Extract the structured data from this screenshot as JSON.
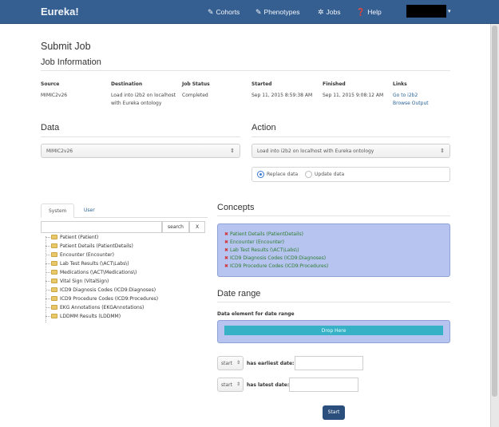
{
  "navbar": {
    "brand": "Eureka!",
    "items": [
      {
        "label": "Cohorts",
        "icon": "pencil-icon"
      },
      {
        "label": "Phenotypes",
        "icon": "pencil-icon"
      },
      {
        "label": "Jobs",
        "icon": "gear-icon"
      },
      {
        "label": "Help",
        "icon": "question-circle-icon"
      }
    ],
    "user_caret": "▾"
  },
  "page": {
    "title": "Submit Job",
    "job_info_heading": "Job Information"
  },
  "job_info": {
    "labels": {
      "source": "Source",
      "destination": "Destination",
      "status": "Job Status",
      "started": "Started",
      "finished": "Finished",
      "links": "Links"
    },
    "source": "MIMIC2v26",
    "destination": "Load into i2b2 on localhost with Eureka ontology",
    "status": "Completed",
    "started": "Sep 11, 2015 8:59:38 AM",
    "finished": "Sep 11, 2015 9:08:12 AM",
    "links": [
      "Go to i2b2",
      "Browse Output"
    ]
  },
  "data_section": {
    "heading": "Data",
    "selected": "MIMIC2v26"
  },
  "action_section": {
    "heading": "Action",
    "selected": "Load into i2b2 on localhost with Eureka ontology",
    "radio_replace": "Replace data",
    "radio_update": "Update data",
    "selected_radio": "replace"
  },
  "tree": {
    "tabs": [
      "System",
      "User"
    ],
    "active_tab": "System",
    "search_label": "search",
    "clear_label": "X",
    "items": [
      "Patient (Patient)",
      "Patient Details (PatientDetails)",
      "Encounter (Encounter)",
      "Lab Test Results (\\ACT\\Labs\\)",
      "Medications (\\ACT\\Medications\\)",
      "Vital Sign (VitalSign)",
      "ICD9 Diagnosis Codes (ICD9:Diagnoses)",
      "ICD9 Procedure Codes (ICD9:Procedures)",
      "EKG Annotations (EKGAnnotations)",
      "LDDMM Results (LDDMM)"
    ]
  },
  "concepts": {
    "heading": "Concepts",
    "remove_symbol": "✖",
    "items": [
      "Patient Details (PatientDetails)",
      "Encounter (Encounter)",
      "Lab Test Results (\\ACT\\Labs\\)",
      "ICD9 Diagnosis Codes (ICD9:Diagnoses)",
      "ICD9 Procedure Codes (ICD9:Procedures)"
    ]
  },
  "date_range": {
    "heading": "Date range",
    "element_label": "Data element for date range",
    "drop_here": "Drop Here",
    "earliest_select": "start",
    "earliest_label": "has earliest date:",
    "latest_select": "start",
    "latest_label": "has latest date:",
    "start_button": "Start"
  }
}
